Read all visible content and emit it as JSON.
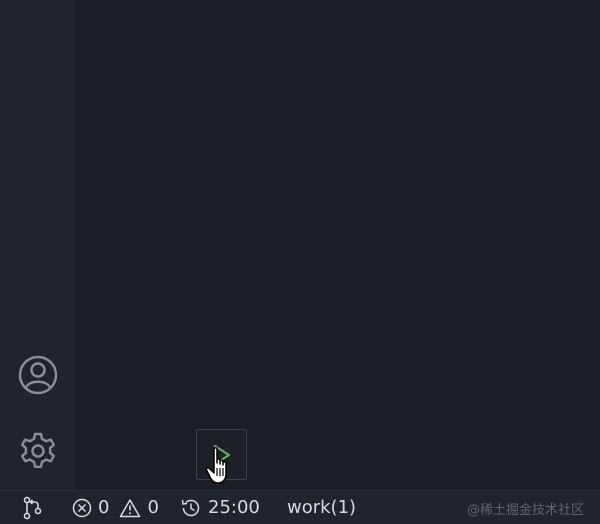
{
  "status_bar": {
    "errors_count": "0",
    "warnings_count": "0",
    "timer_value": "25:00",
    "workspace_label": "work(1)"
  },
  "watermark": "@稀土掘金技术社区",
  "icons": {
    "account": "account-icon",
    "settings": "gear-icon",
    "run": "play-icon",
    "source_control": "source-control-icon",
    "error": "error-icon",
    "warning": "warning-icon",
    "timer": "history-icon"
  },
  "colors": {
    "editor_background": "#1b1e24",
    "bar_background": "#20242c",
    "play_accent": "#5fb25f",
    "icon_gray": "#8a9099"
  }
}
